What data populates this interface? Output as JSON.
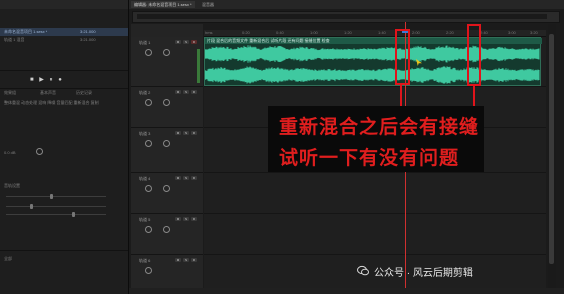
{
  "editor_tabs": [
    {
      "label": "编辑器: 未命名混音项目 1.sesx *",
      "active": true
    },
    {
      "label": "混音器",
      "active": false
    }
  ],
  "timeline": {
    "ruler_labels": [
      "hms",
      "0:20",
      "0:40",
      "1:00",
      "1:20",
      "1:40",
      "2:00",
      "2:20",
      "2:40",
      "3:00",
      "3:20"
    ],
    "clip_title": "片段 混合后的音频文件 重新混合后 试听片段 还有问题 接缝位置 检查"
  },
  "tracks": [
    {
      "name": "轨道 1",
      "mute": "M",
      "solo": "S",
      "record": "R"
    },
    {
      "name": "轨道 2",
      "mute": "M",
      "solo": "S",
      "record": "R"
    },
    {
      "name": "轨道 3",
      "mute": "M",
      "solo": "S",
      "record": "R"
    },
    {
      "name": "轨道 4",
      "mute": "M",
      "solo": "S",
      "record": "R"
    },
    {
      "name": "轨道 5",
      "mute": "M",
      "solo": "S",
      "record": "R"
    },
    {
      "name": "轨道 6",
      "mute": "M",
      "solo": "S",
      "record": "R"
    }
  ],
  "annotation": {
    "line1": "重新混合之后会有接缝",
    "line2": "试听一下有没有问题",
    "color": "#e01e1e"
  },
  "left_panel": {
    "file_rows": [
      "未命名混音项目 1.sesx *",
      "轨道 1 混音"
    ],
    "file_values": [
      "3:21.000",
      "3:21.000"
    ],
    "transport_glyphs": "■ ▶ ⏸ ●",
    "tabs": [
      "效果组",
      "基本声音",
      "历史记录"
    ],
    "text_row": "整体重混 动态处理 混响 降噪 音量匹配 重新混合 复制",
    "value_row": "0.0 dB",
    "section_label": "音轨设置",
    "bottom_label": "全部"
  },
  "watermark": {
    "text": "公众号 · 风云后期剪辑"
  }
}
